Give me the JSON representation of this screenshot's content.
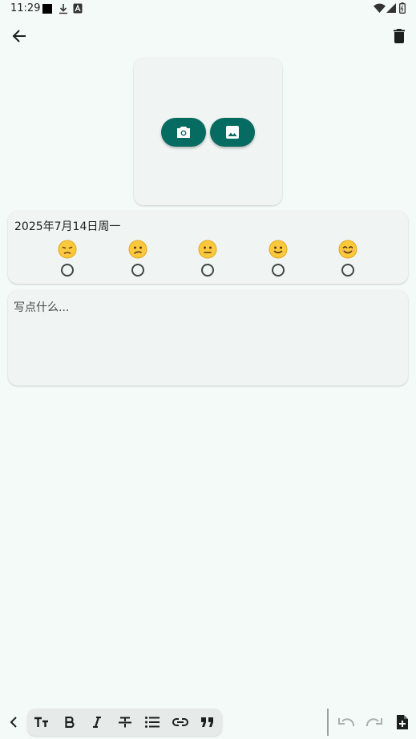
{
  "status_bar": {
    "time": "11:29",
    "left_icons": [
      "notification-square-icon",
      "download-icon",
      "font-a-icon"
    ],
    "right_icons": [
      "wifi-icon",
      "signal-icon",
      "battery-icon"
    ]
  },
  "app_bar": {
    "back_icon": "arrow-back-icon",
    "delete_icon": "delete-icon"
  },
  "photo_card": {
    "camera_icon": "camera-icon",
    "gallery_icon": "image-icon",
    "button_color": "#066b60"
  },
  "mood_card": {
    "date": "2025年7月14日周一",
    "moods": [
      {
        "emoji": "😔",
        "selected": false
      },
      {
        "emoji": "😕",
        "selected": false
      },
      {
        "emoji": "😐",
        "selected": false
      },
      {
        "emoji": "🙂",
        "selected": false
      },
      {
        "emoji": "😊",
        "selected": false
      }
    ]
  },
  "note": {
    "placeholder": "写点什么...",
    "value": ""
  },
  "toolbar": {
    "format_icons": [
      "collapse-chevron-left-icon",
      "text-size-icon",
      "bold-icon",
      "italic-icon",
      "strikethrough-icon",
      "bullet-list-icon",
      "link-icon",
      "quote-icon"
    ],
    "action_icons": [
      "undo-icon",
      "redo-icon",
      "add-note-icon"
    ]
  },
  "colors": {
    "background": "#f4faf8",
    "card": "#f0f4f3",
    "accent": "#066b60"
  }
}
